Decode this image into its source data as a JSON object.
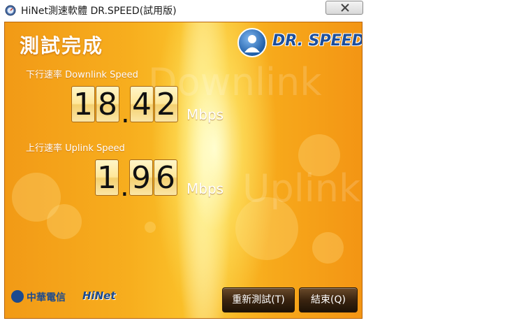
{
  "window": {
    "title": "HiNet測速軟體 DR.SPEED(試用版)",
    "app_icon": "speedometer-icon",
    "close_icon": "close-icon"
  },
  "main": {
    "heading": "測試完成",
    "logo_text": "DR. SPEED",
    "downlink": {
      "label": "下行速率 Downlink  Speed",
      "digits": [
        "1",
        "8",
        "4",
        "2"
      ],
      "value": "18.42",
      "unit": "Mbps",
      "watermark": "Downlink"
    },
    "uplink": {
      "label": "上行速率 Uplink Speed",
      "digits": [
        "1",
        "9",
        "6"
      ],
      "value": "1.96",
      "unit": "Mbps",
      "watermark": "Uplink"
    },
    "decimal_point": "."
  },
  "footer": {
    "brand_cht": "中華電信",
    "brand_hinet": "HiNet",
    "retest_button": "重新測試(T)",
    "exit_button": "結束(Q)"
  },
  "colors": {
    "background_orange": "#f7ae1e",
    "digit_face": "#ffe79a",
    "button_dark": "#3a2410",
    "brand_blue": "#1c4a8e"
  }
}
